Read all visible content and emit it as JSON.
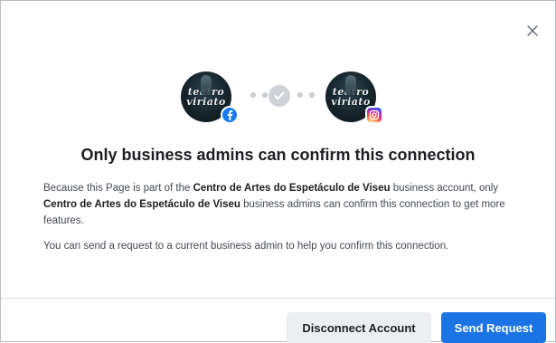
{
  "dialog": {
    "close_symbol": "×",
    "title": "Only business admins can confirm this connection",
    "avatar_left": {
      "brand_line1": "teatro",
      "brand_line2": "viriato",
      "badge_icon": "facebook-icon"
    },
    "avatar_right": {
      "brand_line1": "teatro",
      "brand_line2": "viriato",
      "badge_icon": "instagram-icon"
    },
    "connector_icon": "checkmark-icon",
    "body": {
      "p1_part1": "Because this Page is part of the ",
      "p1_bold1": "Centro de Artes do Espetáculo de Viseu",
      "p1_part2": " business account, only ",
      "p1_bold2": "Centro de Artes do Espetáculo de Viseu",
      "p1_part3": " business admins can confirm this connection to get more features.",
      "p2": "You can send a request to a current business admin to help you confirm this connection."
    },
    "buttons": {
      "disconnect_label": "Disconnect Account",
      "send_label": "Send Request"
    },
    "colors": {
      "primary": "#1b74e4",
      "facebook": "#1877f2"
    }
  }
}
